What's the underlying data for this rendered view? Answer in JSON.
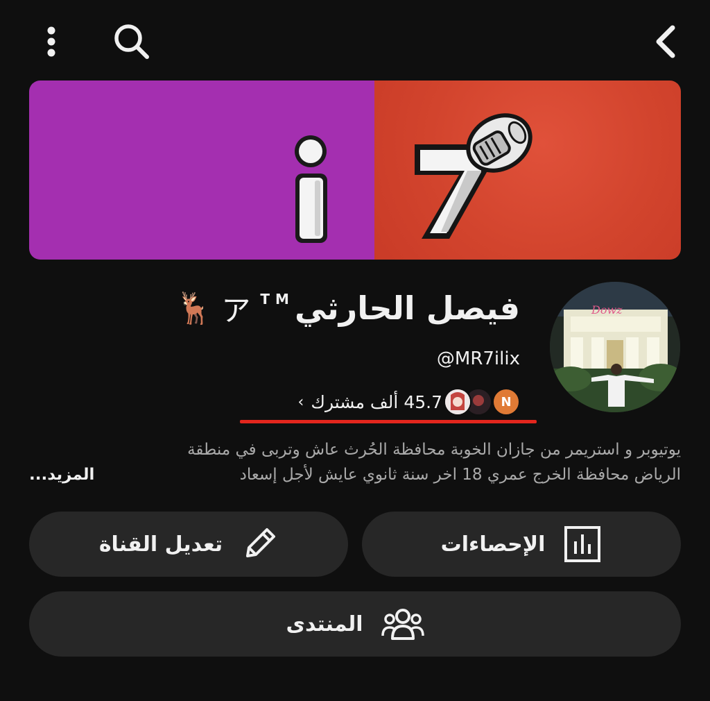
{
  "header": {
    "back_icon": "chevron-left-icon",
    "search_icon": "search-icon",
    "more_icon": "more-vertical-icon"
  },
  "banner": {
    "left_color": "#a42fb0",
    "right_color": "#d2442d"
  },
  "channel": {
    "name": "فيصل الحارثي",
    "name_suffix": "TM",
    "name_kana": "ア",
    "name_emoji": "🦌",
    "handle": "@MR7ilix",
    "subscribers": "45.7 ألف مشترك",
    "subscriber_avatar_initial": "N",
    "chevron": "›"
  },
  "description": {
    "line1": "يوتيوبر و استريمر من جازان الخوبة محافظة الحُرث عاش وتربى في منطقة",
    "line2": "الرياض محافظة الخرج عمري 18 اخر سنة ثانوي عايش لأجل إسعاد",
    "more_label": "المزيد..."
  },
  "buttons": {
    "stats_label": "الإحصاءات",
    "edit_label": "تعديل القناة",
    "community_label": "المنتدى"
  },
  "colors": {
    "background": "#0f0f0f",
    "button_bg": "#272727",
    "accent_red": "#e3261d",
    "secondary_text": "#aaaaaa"
  }
}
